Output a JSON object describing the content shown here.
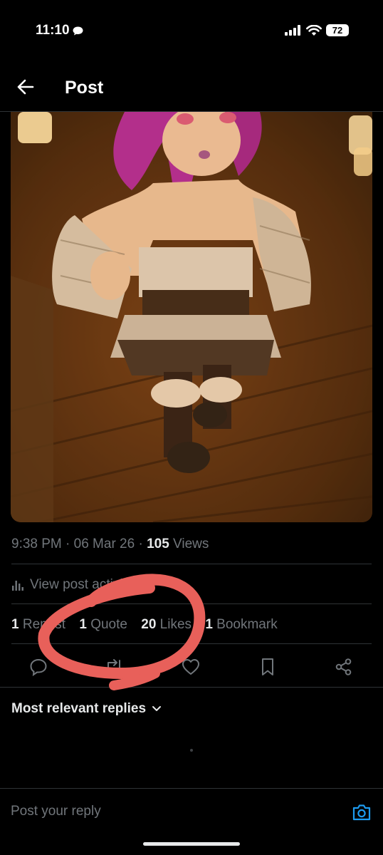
{
  "status_bar": {
    "time": "11:10",
    "battery": "72"
  },
  "header": {
    "title": "Post"
  },
  "post": {
    "timestamp": "9:38 PM · 06 Mar 26 · ",
    "views_count": "105",
    "views_label": " Views",
    "activity_label": "View post activity"
  },
  "stats": {
    "reposts_count": "1",
    "reposts_label": "Repost",
    "quotes_count": "1",
    "quotes_label": "Quote",
    "likes_count": "20",
    "likes_label": "Likes",
    "bookmarks_count": "1",
    "bookmarks_label": "Bookmark"
  },
  "replies": {
    "sort_label": "Most relevant replies"
  },
  "composer": {
    "placeholder": "Post your reply"
  },
  "colors": {
    "background": "#000000",
    "text": "#e7e9ea",
    "muted": "#71767b",
    "accent": "#1d9bf0",
    "annotation": "#e8605a"
  }
}
